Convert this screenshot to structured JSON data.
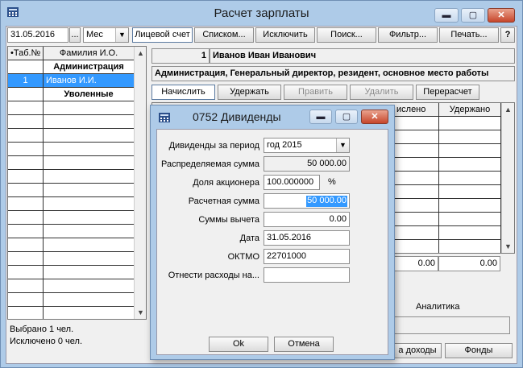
{
  "window": {
    "title": "Расчет зарплаты"
  },
  "toolbar": {
    "date": "31.05.2016",
    "dots": "...",
    "period": "Мес",
    "btn_account": "Лицевой счет",
    "btn_list": "Списком...",
    "btn_exclude": "Исключить",
    "btn_search": "Поиск...",
    "btn_filter": "Фильтр...",
    "btn_print": "Печать...",
    "btn_help": "?"
  },
  "employees": {
    "col_tab": "•Таб.№",
    "col_name": "Фамилия И.О.",
    "group_admin": "Администрация",
    "row1_tab": "1",
    "row1_name": "Иванов И.И.",
    "group_fired": "Уволенные",
    "selected": "Выбрано 1 чел.",
    "excluded": "Исключено 0 чел."
  },
  "employee": {
    "num": "1",
    "name": "Иванов Иван Иванович",
    "info": "Администрация, Генеральный директор, резидент, основное место работы"
  },
  "actions": {
    "accrue": "Начислить",
    "withhold": "Удержать",
    "edit": "Править",
    "delete": "Удалить",
    "recalc": "Перерасчет"
  },
  "accruals": {
    "col_accrued": "ислено",
    "col_withheld": "Удержано",
    "total_accrued": "0.00",
    "total_withheld": "0.00"
  },
  "analytics": {
    "label": "Аналитика"
  },
  "bottom": {
    "btn_income": "а доходы",
    "btn_funds": "Фонды"
  },
  "dialog": {
    "title": "0752 Дивиденды",
    "period_label": "Дивиденды за период",
    "period_value": "год 2015",
    "distributed_label": "Распределяемая сумма",
    "distributed_value": "50 000.00",
    "share_label": "Доля акционера",
    "share_value": "100.000000",
    "share_unit": "%",
    "calc_label": "Расчетная сумма",
    "calc_value": "50 000.00",
    "deduct_label": "Суммы вычета",
    "deduct_value": "0.00",
    "date_label": "Дата",
    "date_value": "31.05.2016",
    "oktmo_label": "ОКТМО",
    "oktmo_value": "22701000",
    "expense_label": "Отнести расходы на...",
    "expense_value": "",
    "ok": "Ok",
    "cancel": "Отмена"
  },
  "icons": {
    "app": "calculator-icon",
    "minimize": "minimize-icon",
    "maximize": "maximize-icon",
    "close": "close-icon",
    "dropdown": "chevron-down-icon"
  },
  "colors": {
    "titlebar": "#aecbe8",
    "selection": "#3399ff",
    "close": "#c7462b"
  }
}
